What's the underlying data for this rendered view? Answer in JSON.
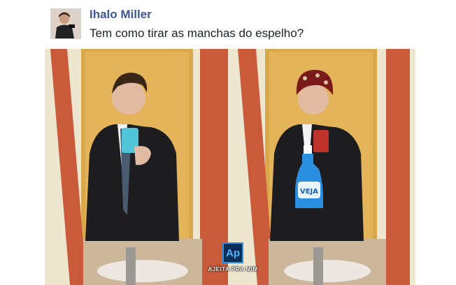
{
  "post": {
    "author": "Ihalo Miller",
    "text": "Tem como tirar as manchas do espelho?"
  },
  "watermark": {
    "logo": "Ap",
    "caption": "AJEITA PRA MIM"
  },
  "bottle": {
    "label": "VEJA"
  },
  "colors": {
    "author_link": "#3b5998",
    "frame_orange": "#c95a3a",
    "door_wood": "#d9a84a",
    "logo_blue": "#0b2e57"
  }
}
